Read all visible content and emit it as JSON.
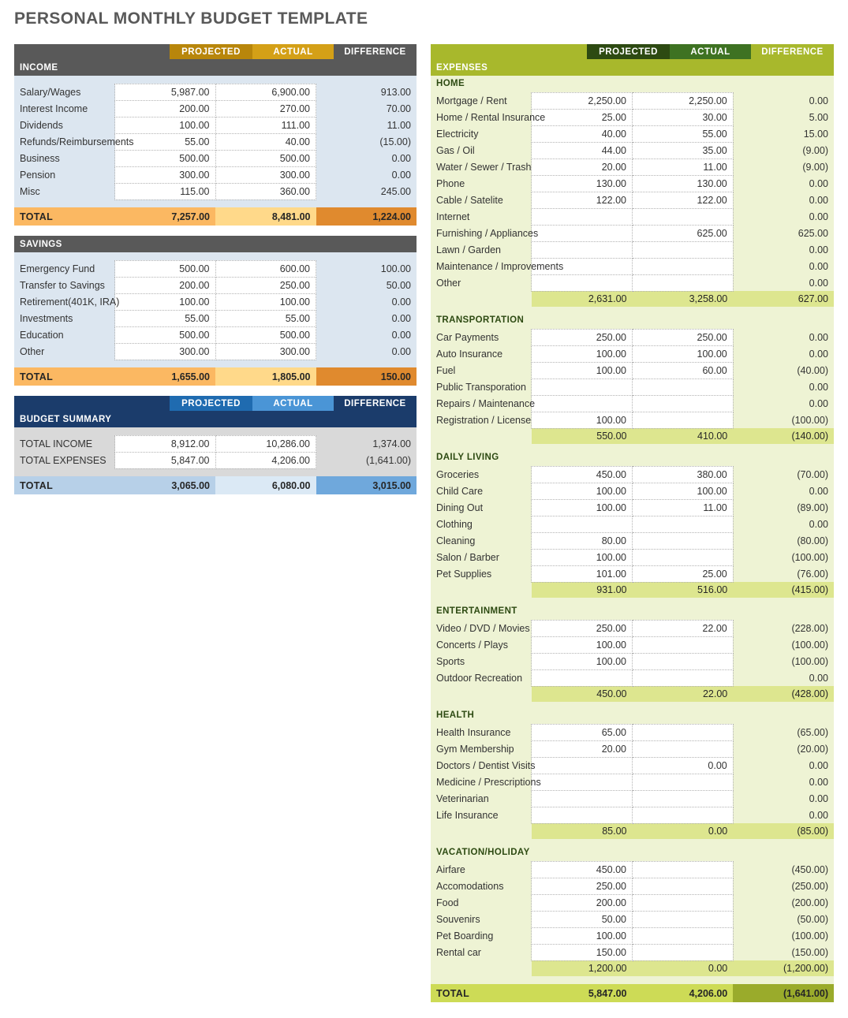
{
  "page_title": "PERSONAL MONTHLY BUDGET TEMPLATE",
  "columns": {
    "projected": "PROJECTED",
    "actual": "ACTUAL",
    "difference": "DIFFERENCE"
  },
  "colors": {
    "title": "#595959",
    "income_bar": "#595959",
    "income_body": "#dce6f0",
    "income_head_projected": "#b8860b",
    "income_head_actual": "#d4a017",
    "income_total_base": "#fbb862",
    "income_total_actual": "#ffd98a",
    "income_total_difference": "#e08a2e",
    "summary_bar": "#1b3c6b",
    "summary_body": "#d9d9d9",
    "summary_head_projected": "#1f6bb0",
    "summary_head_actual": "#4a95d6",
    "summary_total_base": "#b7d0e8",
    "summary_total_actual": "#dbe9f5",
    "summary_total_difference": "#6fa8dc",
    "expenses_bar": "#a8b82c",
    "expenses_body": "#eef3d4",
    "expenses_head_projected": "#2d4a12",
    "expenses_head_actual": "#3e7222",
    "expenses_subtotal": "#dde68f",
    "expenses_total_base": "#cddb56",
    "expenses_total_difference": "#9aab2b"
  },
  "income": {
    "section_label": "INCOME",
    "total_label": "TOTAL",
    "rows": [
      {
        "label": "Salary/Wages",
        "projected": "5,987.00",
        "actual": "6,900.00",
        "difference": "913.00"
      },
      {
        "label": "Interest Income",
        "projected": "200.00",
        "actual": "270.00",
        "difference": "70.00"
      },
      {
        "label": "Dividends",
        "projected": "100.00",
        "actual": "111.00",
        "difference": "11.00"
      },
      {
        "label": "Refunds/Reimbursements",
        "projected": "55.00",
        "actual": "40.00",
        "difference": "(15.00)"
      },
      {
        "label": "Business",
        "projected": "500.00",
        "actual": "500.00",
        "difference": "0.00"
      },
      {
        "label": "Pension",
        "projected": "300.00",
        "actual": "300.00",
        "difference": "0.00"
      },
      {
        "label": "Misc",
        "projected": "115.00",
        "actual": "360.00",
        "difference": "245.00"
      }
    ],
    "total": {
      "projected": "7,257.00",
      "actual": "8,481.00",
      "difference": "1,224.00"
    }
  },
  "savings": {
    "section_label": "SAVINGS",
    "total_label": "TOTAL",
    "rows": [
      {
        "label": "Emergency Fund",
        "projected": "500.00",
        "actual": "600.00",
        "difference": "100.00"
      },
      {
        "label": "Transfer to Savings",
        "projected": "200.00",
        "actual": "250.00",
        "difference": "50.00"
      },
      {
        "label": "Retirement(401K, IRA)",
        "projected": "100.00",
        "actual": "100.00",
        "difference": "0.00"
      },
      {
        "label": "Investments",
        "projected": "55.00",
        "actual": "55.00",
        "difference": "0.00"
      },
      {
        "label": "Education",
        "projected": "500.00",
        "actual": "500.00",
        "difference": "0.00"
      },
      {
        "label": "Other",
        "projected": "300.00",
        "actual": "300.00",
        "difference": "0.00"
      }
    ],
    "total": {
      "projected": "1,655.00",
      "actual": "1,805.00",
      "difference": "150.00"
    }
  },
  "budget_summary": {
    "section_label": "BUDGET SUMMARY",
    "total_label": "TOTAL",
    "rows": [
      {
        "label": "TOTAL INCOME",
        "projected": "8,912.00",
        "actual": "10,286.00",
        "difference": "1,374.00"
      },
      {
        "label": "TOTAL EXPENSES",
        "projected": "5,847.00",
        "actual": "4,206.00",
        "difference": "(1,641.00)"
      }
    ],
    "total": {
      "projected": "3,065.00",
      "actual": "6,080.00",
      "difference": "3,015.00"
    }
  },
  "expenses": {
    "section_label": "EXPENSES",
    "total_label": "TOTAL",
    "groups": [
      {
        "name": "HOME",
        "rows": [
          {
            "label": "Mortgage / Rent",
            "projected": "2,250.00",
            "actual": "2,250.00",
            "difference": "0.00"
          },
          {
            "label": "Home / Rental Insurance",
            "projected": "25.00",
            "actual": "30.00",
            "difference": "5.00"
          },
          {
            "label": "Electricity",
            "projected": "40.00",
            "actual": "55.00",
            "difference": "15.00"
          },
          {
            "label": "Gas / Oil",
            "projected": "44.00",
            "actual": "35.00",
            "difference": "(9.00)"
          },
          {
            "label": "Water / Sewer / Trash",
            "projected": "20.00",
            "actual": "11.00",
            "difference": "(9.00)"
          },
          {
            "label": "Phone",
            "projected": "130.00",
            "actual": "130.00",
            "difference": "0.00"
          },
          {
            "label": "Cable / Satelite",
            "projected": "122.00",
            "actual": "122.00",
            "difference": "0.00"
          },
          {
            "label": "Internet",
            "projected": "",
            "actual": "",
            "difference": "0.00"
          },
          {
            "label": "Furnishing / Appliances",
            "projected": "",
            "actual": "625.00",
            "difference": "625.00"
          },
          {
            "label": "Lawn / Garden",
            "projected": "",
            "actual": "",
            "difference": "0.00"
          },
          {
            "label": "Maintenance / Improvements",
            "projected": "",
            "actual": "",
            "difference": "0.00"
          },
          {
            "label": "Other",
            "projected": "",
            "actual": "",
            "difference": "0.00"
          }
        ],
        "subtotal": {
          "projected": "2,631.00",
          "actual": "3,258.00",
          "difference": "627.00"
        }
      },
      {
        "name": "TRANSPORTATION",
        "rows": [
          {
            "label": "Car Payments",
            "projected": "250.00",
            "actual": "250.00",
            "difference": "0.00"
          },
          {
            "label": "Auto Insurance",
            "projected": "100.00",
            "actual": "100.00",
            "difference": "0.00"
          },
          {
            "label": "Fuel",
            "projected": "100.00",
            "actual": "60.00",
            "difference": "(40.00)"
          },
          {
            "label": "Public Transporation",
            "projected": "",
            "actual": "",
            "difference": "0.00"
          },
          {
            "label": "Repairs / Maintenance",
            "projected": "",
            "actual": "",
            "difference": "0.00"
          },
          {
            "label": "Registration / License",
            "projected": "100.00",
            "actual": "",
            "difference": "(100.00)"
          }
        ],
        "subtotal": {
          "projected": "550.00",
          "actual": "410.00",
          "difference": "(140.00)"
        }
      },
      {
        "name": "DAILY LIVING",
        "rows": [
          {
            "label": "Groceries",
            "projected": "450.00",
            "actual": "380.00",
            "difference": "(70.00)"
          },
          {
            "label": "Child Care",
            "projected": "100.00",
            "actual": "100.00",
            "difference": "0.00"
          },
          {
            "label": "Dining Out",
            "projected": "100.00",
            "actual": "11.00",
            "difference": "(89.00)"
          },
          {
            "label": "Clothing",
            "projected": "",
            "actual": "",
            "difference": "0.00"
          },
          {
            "label": "Cleaning",
            "projected": "80.00",
            "actual": "",
            "difference": "(80.00)"
          },
          {
            "label": "Salon / Barber",
            "projected": "100.00",
            "actual": "",
            "difference": "(100.00)"
          },
          {
            "label": "Pet Supplies",
            "projected": "101.00",
            "actual": "25.00",
            "difference": "(76.00)"
          }
        ],
        "subtotal": {
          "projected": "931.00",
          "actual": "516.00",
          "difference": "(415.00)"
        }
      },
      {
        "name": "ENTERTAINMENT",
        "rows": [
          {
            "label": "Video / DVD / Movies",
            "projected": "250.00",
            "actual": "22.00",
            "difference": "(228.00)"
          },
          {
            "label": "Concerts / Plays",
            "projected": "100.00",
            "actual": "",
            "difference": "(100.00)"
          },
          {
            "label": "Sports",
            "projected": "100.00",
            "actual": "",
            "difference": "(100.00)"
          },
          {
            "label": "Outdoor Recreation",
            "projected": "",
            "actual": "",
            "difference": "0.00"
          }
        ],
        "subtotal": {
          "projected": "450.00",
          "actual": "22.00",
          "difference": "(428.00)"
        }
      },
      {
        "name": "HEALTH",
        "rows": [
          {
            "label": "Health Insurance",
            "projected": "65.00",
            "actual": "",
            "difference": "(65.00)"
          },
          {
            "label": "Gym Membership",
            "projected": "20.00",
            "actual": "",
            "difference": "(20.00)"
          },
          {
            "label": "Doctors / Dentist Visits",
            "projected": "",
            "actual": "0.00",
            "difference": "0.00"
          },
          {
            "label": "Medicine / Prescriptions",
            "projected": "",
            "actual": "",
            "difference": "0.00"
          },
          {
            "label": "Veterinarian",
            "projected": "",
            "actual": "",
            "difference": "0.00"
          },
          {
            "label": "Life Insurance",
            "projected": "",
            "actual": "",
            "difference": "0.00"
          }
        ],
        "subtotal": {
          "projected": "85.00",
          "actual": "0.00",
          "difference": "(85.00)"
        }
      },
      {
        "name": "VACATION/HOLIDAY",
        "rows": [
          {
            "label": "Airfare",
            "projected": "450.00",
            "actual": "",
            "difference": "(450.00)"
          },
          {
            "label": "Accomodations",
            "projected": "250.00",
            "actual": "",
            "difference": "(250.00)"
          },
          {
            "label": "Food",
            "projected": "200.00",
            "actual": "",
            "difference": "(200.00)"
          },
          {
            "label": "Souvenirs",
            "projected": "50.00",
            "actual": "",
            "difference": "(50.00)"
          },
          {
            "label": "Pet Boarding",
            "projected": "100.00",
            "actual": "",
            "difference": "(100.00)"
          },
          {
            "label": "Rental car",
            "projected": "150.00",
            "actual": "",
            "difference": "(150.00)"
          }
        ],
        "subtotal": {
          "projected": "1,200.00",
          "actual": "0.00",
          "difference": "(1,200.00)"
        }
      }
    ],
    "total": {
      "projected": "5,847.00",
      "actual": "4,206.00",
      "difference": "(1,641.00)"
    }
  }
}
